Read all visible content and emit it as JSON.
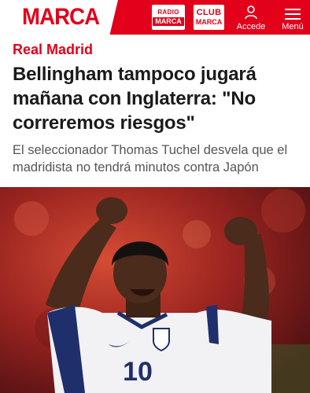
{
  "header": {
    "logo": "MARCA",
    "radio": {
      "top": "RADIO",
      "bottom": "MARCA"
    },
    "club": {
      "top": "CLUB",
      "bottom": "MARCA"
    },
    "login_label": "Accede",
    "menu_label": "Menú",
    "brand_color": "#e2001a"
  },
  "article": {
    "category": "Real Madrid",
    "headline": "Bellingham tampoco jugará mañana con Inglaterra: \"No correremos riesgos\"",
    "subtitle": "El seleccionador Thomas Tuchel desvela que el madridista no tendrá minutos contra Japón",
    "photo": {
      "shirt_number": "10"
    }
  }
}
